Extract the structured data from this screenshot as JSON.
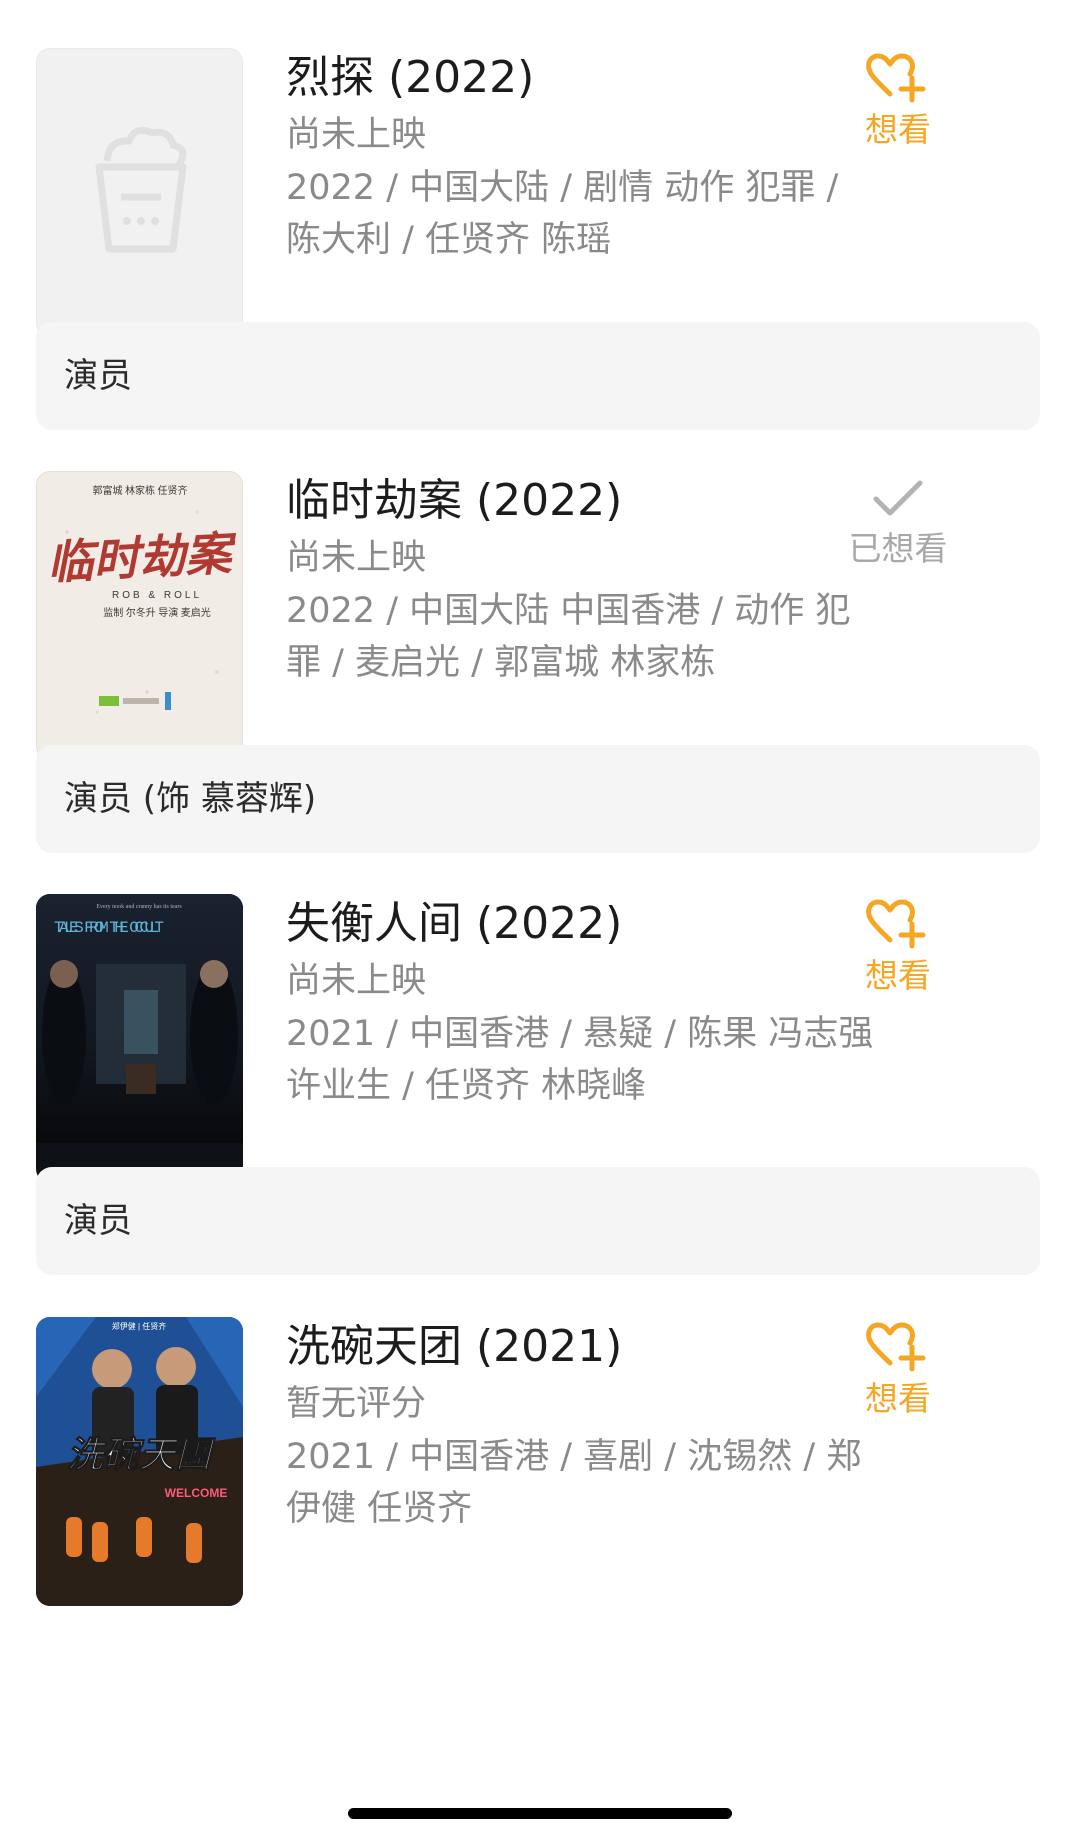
{
  "movies": [
    {
      "title": "烈探 (2022)",
      "status": "尚未上映",
      "meta": "2022 / 中国大陆 / 剧情 动作 犯罪 / 陈大利 / 任贤齐 陈瑶",
      "action_label": "想看",
      "action_icon": "heart-plus-icon",
      "role": "演员",
      "poster": "placeholder"
    },
    {
      "title": "临时劫案 (2022)",
      "status": "尚未上映",
      "meta": "2022 / 中国大陆 中国香港 / 动作 犯罪 / 麦启光 / 郭富城 林家栋",
      "action_label": "已想看",
      "action_icon": "check-icon",
      "role": "演员 (饰 慕蓉辉)",
      "poster": "rob-and-roll"
    },
    {
      "title": "失衡人间 (2022)",
      "status": "尚未上映",
      "meta": "2021 / 中国香港 / 悬疑 / 陈果 冯志强 许业生 / 任贤齐 林晓峰",
      "action_label": "想看",
      "action_icon": "heart-plus-icon",
      "role": "演员",
      "poster": "tales-from-the-occult"
    },
    {
      "title": "洗碗天团 (2021)",
      "status": "暂无评分",
      "meta": "2021 / 中国香港 / 喜剧 / 沈锡然 / 郑伊健 任贤齐",
      "action_label": "想看",
      "action_icon": "heart-plus-icon",
      "poster": "dishwasher-crew"
    }
  ],
  "posters": {
    "p2_title": "临时劫案",
    "p2_sub": "ROB & ROLL",
    "p2_cast": "郭富城    林家栋    任贤齐",
    "p2_credit": "监制 尔冬升   导演 麦启光",
    "p3_tagline": "Every nook and cranny has its tears",
    "p3_title": "TALES FROM THE OCCULT",
    "p4_title": "洗碗天團",
    "p4_cast": "郑伊健 | 任贤齐",
    "p4_sign": "WELCOME"
  },
  "colors": {
    "accent": "#f5a623",
    "muted": "#a8a8a8",
    "role_bg": "#f5f5f5"
  }
}
